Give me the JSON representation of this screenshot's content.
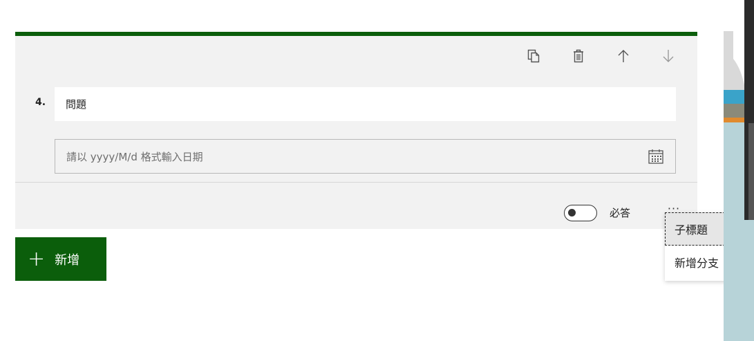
{
  "toolbar": {
    "copy_icon": "copy-icon",
    "delete_icon": "trash-icon",
    "up_icon": "arrow-up-icon",
    "down_icon": "arrow-down-icon"
  },
  "question": {
    "number": "4.",
    "title": "問題",
    "date_placeholder": "請以 yyyy/M/d 格式輸入日期"
  },
  "footer": {
    "required_label": "必答",
    "required_on": false,
    "more": "···"
  },
  "add_button": {
    "plus": "+",
    "label": "新增"
  },
  "menu": {
    "items": [
      {
        "label": "子標題",
        "selected": true
      },
      {
        "label": "新增分支",
        "selected": false
      }
    ]
  },
  "colors": {
    "accent": "#0b5e0b",
    "card_bg": "#f2f2f2"
  }
}
